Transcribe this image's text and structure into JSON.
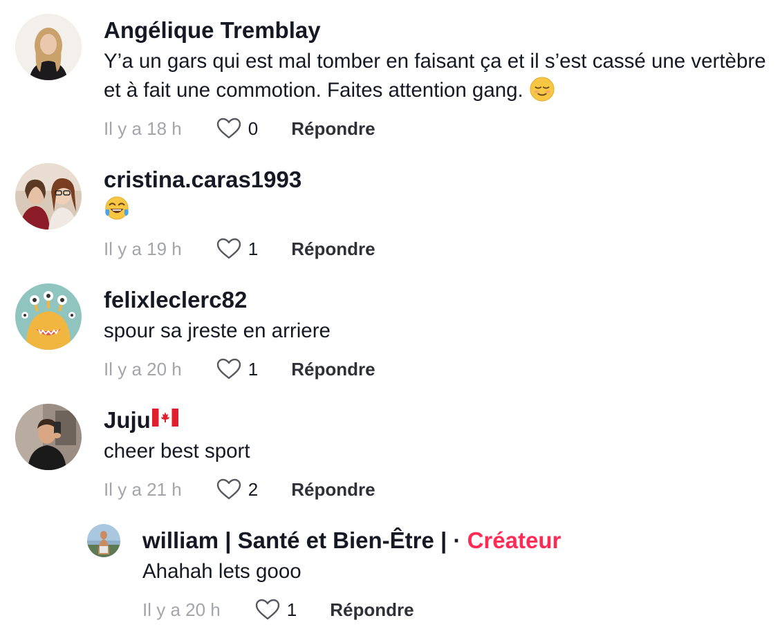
{
  "comments": [
    {
      "username": "Angélique Tremblay",
      "text": "Y’a un gars qui est mal tomber en faisant ça et il s’est cassé une vertèbre et à fait une commotion. Faites attention gang.",
      "emoji": "relieved-face",
      "time": "Il y a 18 h",
      "likes": "0",
      "reply_label": "Répondre"
    },
    {
      "username": "cristina.caras1993",
      "text": "",
      "emoji": "tears-of-joy-face",
      "time": "Il y a 19 h",
      "likes": "1",
      "reply_label": "Répondre"
    },
    {
      "username": "felixleclerc82",
      "text": "spour sa jreste en arriere",
      "time": "Il y a 20 h",
      "likes": "1",
      "reply_label": "Répondre"
    },
    {
      "username": "Juju",
      "username_flag": "canada-flag",
      "text": "cheer best sport",
      "time": "Il y a 21 h",
      "likes": "2",
      "reply_label": "Répondre"
    }
  ],
  "reply": {
    "username": "william | Santé et Bien-Être |",
    "separator": "·",
    "creator_label": "Créateur",
    "text": "Ahahah lets gooo",
    "time": "Il y a 20 h",
    "likes": "1",
    "reply_label": "Répondre"
  },
  "colors": {
    "creator_accent": "#fe2c55",
    "time_gray": "#a4a5aa"
  }
}
